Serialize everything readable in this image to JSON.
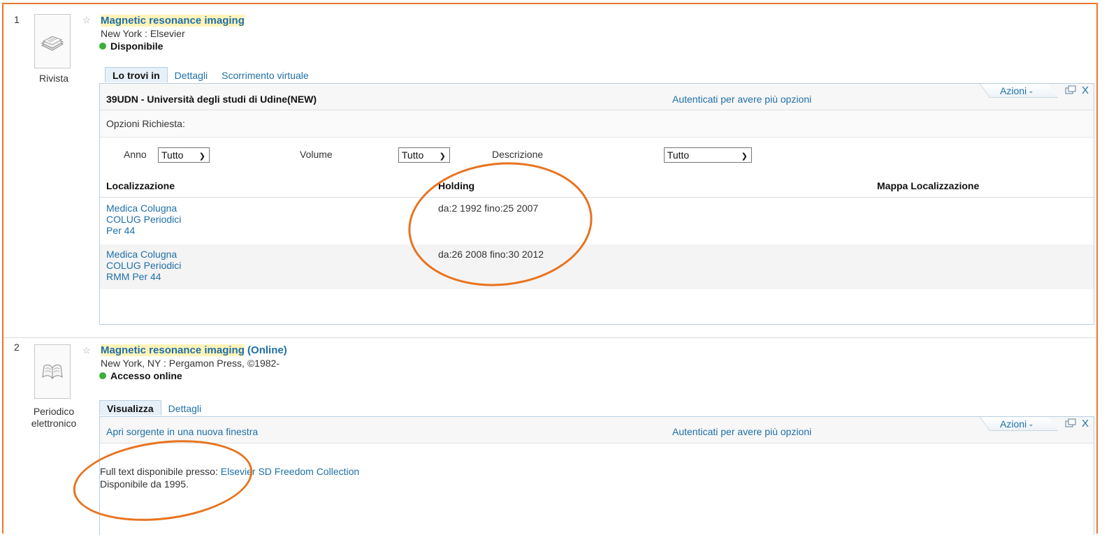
{
  "results": [
    {
      "number": "1",
      "type_label": "Rivista",
      "title_highlight": "Magnetic resonance imaging",
      "title_suffix": "",
      "publisher": "New York : Elsevier",
      "status": "Disponibile",
      "tabs": [
        "Lo trovi in",
        "Dettagli",
        "Scorrimento virtuale"
      ],
      "library": "39UDN - Università degli studi di Udine(NEW)",
      "login_link": "Autenticati per avere più opzioni",
      "actions_label": "Azioni",
      "close_label": "X",
      "request_options": "Opzioni Richiesta:",
      "filters": {
        "year_label": "Anno",
        "year_value": "Tutto",
        "volume_label": "Volume",
        "volume_value": "Tutto",
        "description_label": "Descrizione",
        "description_value": "Tutto"
      },
      "columns": [
        "Localizzazione",
        "Holding",
        "Mappa Localizzazione"
      ],
      "holdings": [
        {
          "loc1": "Medica Colugna",
          "loc2": "COLUG Periodici",
          "loc3": "Per 44",
          "holding": "da:2 1992 fino:25 2007"
        },
        {
          "loc1": "Medica Colugna",
          "loc2": "COLUG Periodici",
          "loc3": "RMM Per 44",
          "holding": "da:26 2008 fino:30 2012"
        }
      ]
    },
    {
      "number": "2",
      "type_label_1": "Periodico",
      "type_label_2": "elettronico",
      "title_highlight": "Magnetic resonance imaging",
      "title_suffix": " (Online)",
      "publisher": "New York, NY : Pergamon Press, ©1982-",
      "status": "Accesso online",
      "tabs": [
        "Visualizza",
        "Dettagli"
      ],
      "open_source": "Apri sorgente in una nuova finestra",
      "login_link": "Autenticati per avere più opzioni",
      "actions_label": "Azioni",
      "close_label": "X",
      "fulltext_label": "Full text disponibile presso: ",
      "fulltext_link": "Elsevier SD Freedom Collection",
      "available_from": "Disponibile da 1995."
    }
  ],
  "colors": {
    "accent": "#e8772e",
    "link": "#1f6fa8",
    "available": "#3cae3c",
    "tab_active_bg": "#e6f0f8"
  },
  "icons": [
    "star-icon",
    "journal-thumbnail-icon",
    "ejournal-thumbnail-icon",
    "dropdown-chevron-icon",
    "popout-window-icon",
    "close-icon",
    "actions-chevron-icon"
  ]
}
